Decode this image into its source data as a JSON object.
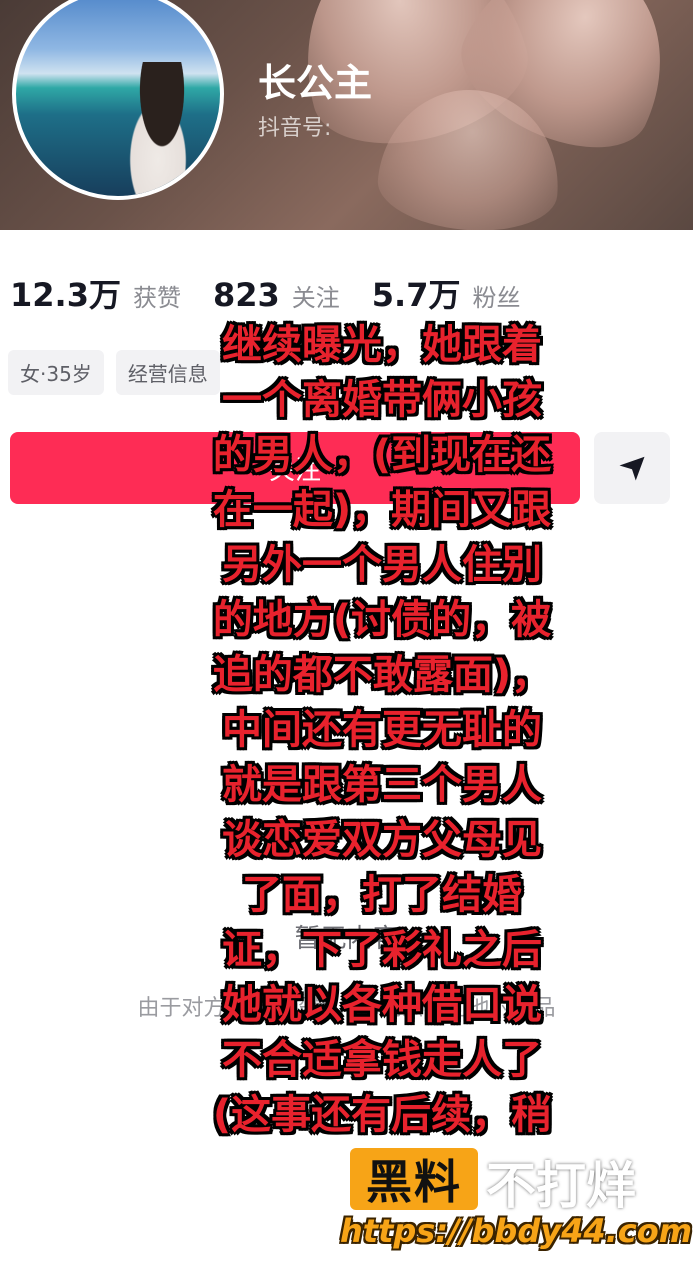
{
  "profile": {
    "name": "长公主",
    "douyin_id_label": "抖音号:"
  },
  "stats": [
    {
      "value": "12.3万",
      "label": "获赞"
    },
    {
      "value": "823",
      "label": "关注"
    },
    {
      "value": "5.7万",
      "label": "粉丝"
    }
  ],
  "tags": [
    "女·35岁",
    "经营信息"
  ],
  "actions": {
    "follow_label": "关注",
    "share_icon": "paper-plane-icon"
  },
  "empty_state": {
    "title": "暂无内容",
    "description": "由于对方的隐私设置，你无法看到他的作品"
  },
  "overlay_text": [
    "继续曝光，她跟着",
    "一个离婚带俩小孩",
    "的男人，(到现在还",
    "在一起)，期间又跟",
    "另外一个男人住别",
    "的地方(讨债的，被",
    "追的都不敢露面)，",
    "中间还有更无耻的",
    "就是跟第三个男人",
    "谈恋爱双方父母见",
    "了面，打了结婚",
    "证，下了彩礼之后",
    "她就以各种借口说",
    "不合适拿钱走人了",
    "(这事还有后续，稍"
  ],
  "watermark": {
    "badge": "黑料",
    "text": "不打烊",
    "url": "https://bbdy44.com"
  },
  "colors": {
    "follow_button": "#fe2c55",
    "overlay_text": "#e8222d",
    "watermark_orange": "#f7a417"
  }
}
